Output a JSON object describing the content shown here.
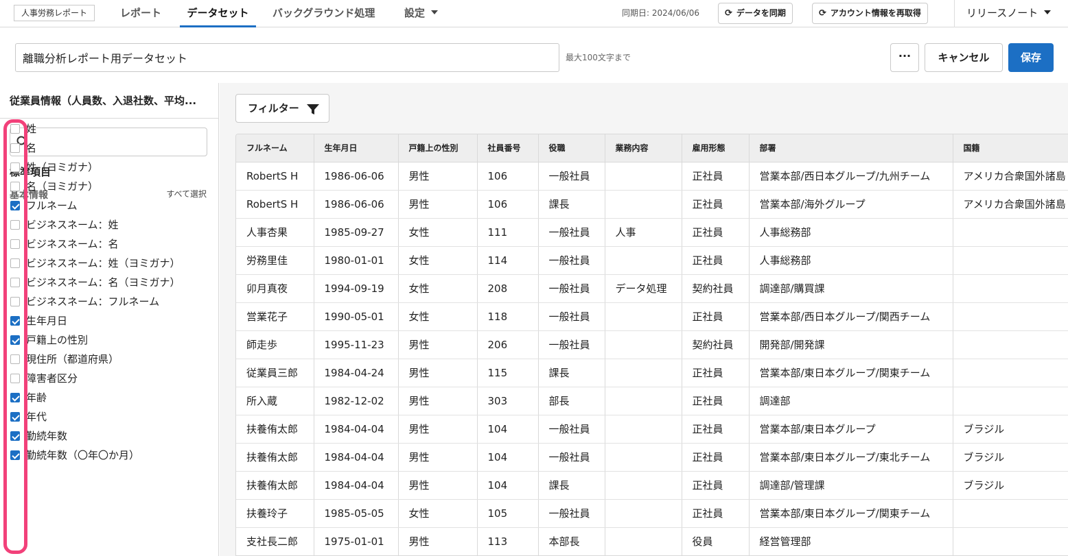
{
  "brand": "人事労務レポート",
  "nav": {
    "reports": "レポート",
    "datasets": "データセット",
    "background": "バックグラウンド処理",
    "settings": "設定"
  },
  "sync_date": "同期日: 2024/06/06",
  "buttons": {
    "sync": "データを同期",
    "refetch": "アカウント情報を再取得",
    "release_notes": "リリースノート",
    "more": "···",
    "cancel": "キャンセル",
    "save": "保存",
    "filter": "フィルター"
  },
  "dataset": {
    "name": "離職分析レポート用データセット",
    "hint": "最大100文字まで"
  },
  "sidebar": {
    "heading": "従業員情報（人員数、入退社数、平均...",
    "search_placeholder": "",
    "standard_label": "標準項目",
    "basic_label": "基本情報",
    "select_all": "すべて選択",
    "fields": [
      {
        "label": "姓",
        "checked": false
      },
      {
        "label": "名",
        "checked": false
      },
      {
        "label": "姓（ヨミガナ）",
        "checked": false
      },
      {
        "label": "名（ヨミガナ）",
        "checked": false
      },
      {
        "label": "フルネーム",
        "checked": true
      },
      {
        "label": "ビジネスネーム：姓",
        "checked": false
      },
      {
        "label": "ビジネスネーム：名",
        "checked": false
      },
      {
        "label": "ビジネスネーム：姓（ヨミガナ）",
        "checked": false
      },
      {
        "label": "ビジネスネーム：名（ヨミガナ）",
        "checked": false
      },
      {
        "label": "ビジネスネーム：フルネーム",
        "checked": false
      },
      {
        "label": "生年月日",
        "checked": true
      },
      {
        "label": "戸籍上の性別",
        "checked": true
      },
      {
        "label": "現住所（都道府県）",
        "checked": false
      },
      {
        "label": "障害者区分",
        "checked": false
      },
      {
        "label": "年齢",
        "checked": true
      },
      {
        "label": "年代",
        "checked": true
      },
      {
        "label": "勤続年数",
        "checked": true
      },
      {
        "label": "勤続年数（〇年〇か月）",
        "checked": true
      }
    ]
  },
  "table": {
    "columns": [
      "フルネーム",
      "生年月日",
      "戸籍上の性別",
      "社員番号",
      "役職",
      "業務内容",
      "雇用形態",
      "部署",
      "国籍"
    ],
    "rows": [
      [
        "RobertS H",
        "1986-06-06",
        "男性",
        "106",
        "一般社員",
        "",
        "正社員",
        "営業本部/西日本グループ/九州チーム",
        "アメリカ合衆国外諸島"
      ],
      [
        "RobertS H",
        "1986-06-06",
        "男性",
        "106",
        "課長",
        "",
        "正社員",
        "営業本部/海外グループ",
        "アメリカ合衆国外諸島"
      ],
      [
        "人事杏果",
        "1985-09-27",
        "女性",
        "111",
        "一般社員",
        "人事",
        "正社員",
        "人事総務部",
        ""
      ],
      [
        "労務里佳",
        "1980-01-01",
        "女性",
        "114",
        "一般社員",
        "",
        "正社員",
        "人事総務部",
        ""
      ],
      [
        "卯月真夜",
        "1994-09-19",
        "女性",
        "208",
        "一般社員",
        "データ処理",
        "契約社員",
        "調達部/購買課",
        ""
      ],
      [
        "営業花子",
        "1990-05-01",
        "女性",
        "118",
        "一般社員",
        "",
        "正社員",
        "営業本部/西日本グループ/関西チーム",
        ""
      ],
      [
        "師走歩",
        "1995-11-23",
        "男性",
        "206",
        "一般社員",
        "",
        "契約社員",
        "開発部/開発課",
        ""
      ],
      [
        "従業員三郎",
        "1984-04-24",
        "男性",
        "115",
        "課長",
        "",
        "正社員",
        "営業本部/東日本グループ/関東チーム",
        ""
      ],
      [
        "所入蔵",
        "1982-12-02",
        "男性",
        "303",
        "部長",
        "",
        "正社員",
        "調達部",
        ""
      ],
      [
        "扶養侑太郎",
        "1984-04-04",
        "男性",
        "104",
        "一般社員",
        "",
        "正社員",
        "営業本部/東日本グループ",
        "ブラジル"
      ],
      [
        "扶養侑太郎",
        "1984-04-04",
        "男性",
        "104",
        "一般社員",
        "",
        "正社員",
        "営業本部/東日本グループ/東北チーム",
        "ブラジル"
      ],
      [
        "扶養侑太郎",
        "1984-04-04",
        "男性",
        "104",
        "課長",
        "",
        "正社員",
        "調達部/管理課",
        "ブラジル"
      ],
      [
        "扶養玲子",
        "1985-05-05",
        "女性",
        "105",
        "一般社員",
        "",
        "正社員",
        "営業本部/東日本グループ/関東チーム",
        ""
      ],
      [
        "支社長二郎",
        "1975-01-01",
        "男性",
        "113",
        "本部長",
        "",
        "役員",
        "経営管理部",
        ""
      ]
    ]
  },
  "colors": {
    "accent": "#1c6fc4",
    "highlight": "#f2417a"
  }
}
